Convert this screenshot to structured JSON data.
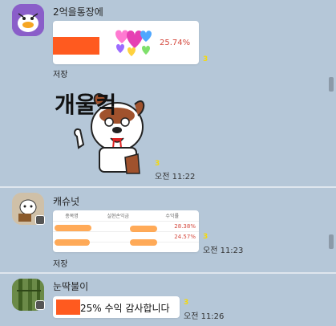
{
  "messages": [
    {
      "sender": "2억을통장에",
      "card_value": "25.74%",
      "save_label": "저장",
      "unread": "3",
      "time": "오전 11:22"
    },
    {
      "sender": "캐슈넛",
      "table_headers": [
        "종목명",
        "실현손익금",
        "수익률"
      ],
      "rows": [
        {
          "pct": "28.38%"
        },
        {
          "pct": "24.57%"
        }
      ],
      "save_label": "저장",
      "unread": "3",
      "time": "오전 11:23"
    },
    {
      "sender": "눈딱불이",
      "text": "25% 수익 감사합니다",
      "unread": "3",
      "time": "오전 11:26"
    }
  ],
  "sticker_text": "개울컥",
  "icons": [
    "duck-avatar-icon",
    "dog-avatar-icon",
    "bamboo-avatar-icon",
    "heart-sticker-icon",
    "crying-dog-sticker-icon",
    "profile-badge-icon"
  ],
  "colors": {
    "background": "#b5c7d8",
    "unread": "#f5d90a",
    "redaction": "#ff5a1f",
    "profit": "#d4473c"
  }
}
